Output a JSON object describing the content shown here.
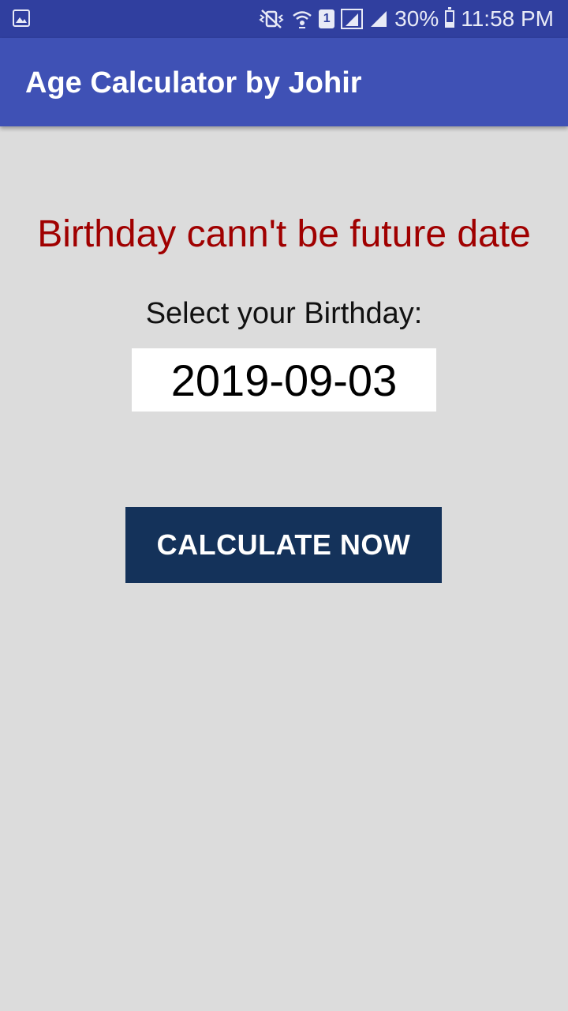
{
  "status_bar": {
    "left_icon": "image-icon",
    "icons": [
      "mute-vibrate-icon",
      "wifi-icon",
      "sim-icon",
      "signal-icon",
      "signal-icon"
    ],
    "sim_label": "1",
    "battery_text": "30%",
    "battery_level": 0.3,
    "time": "11:58 PM",
    "color": "#303f9f"
  },
  "app_bar": {
    "title": "Age Calculator by Johir",
    "color": "#3f51b5"
  },
  "main": {
    "error_message": "Birthday cann't be future date",
    "error_color": "#a00000",
    "select_label": "Select your Birthday:",
    "birthday_value": "2019-09-03",
    "calculate_label": "CALCULATE NOW",
    "button_color": "#14325a",
    "background_color": "#dcdcdc"
  }
}
